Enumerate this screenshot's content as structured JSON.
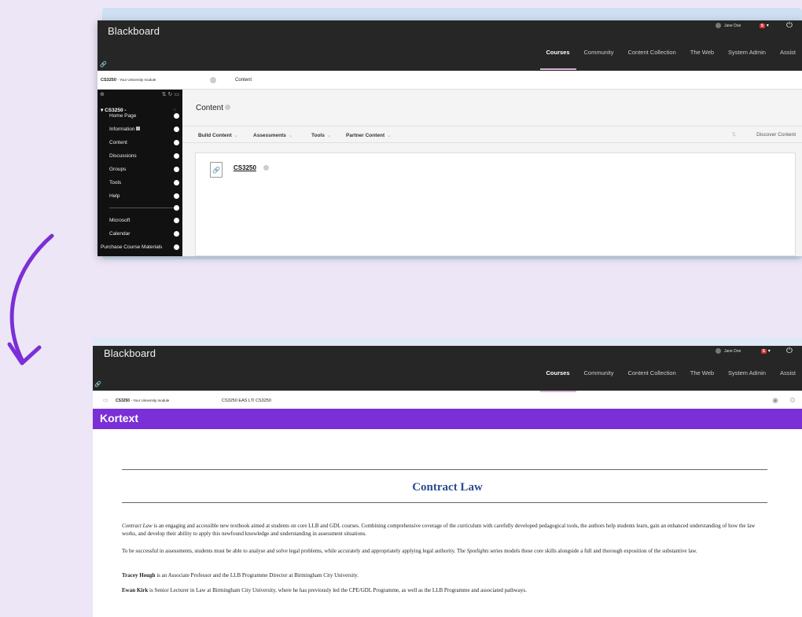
{
  "colors": {
    "kortext_purple": "#7b2fd6",
    "title_blue": "#2a4c93",
    "arrow_purple": "#7b2fd6"
  },
  "shot1": {
    "header": {
      "logo": "Blackboard",
      "user": "Jane Doe",
      "badge": "5",
      "nav": [
        "Courses",
        "Community",
        "Content Collection",
        "The Web",
        "System Admin",
        "Assist"
      ]
    },
    "breadcrumb": {
      "course_code": "CS3250",
      "course_desc": "- Your University module",
      "page": "Content"
    },
    "sidebar": {
      "course": "CS3250 -",
      "items": [
        "Home Page",
        "Information",
        "Content",
        "Discussions",
        "Groups",
        "Tools",
        "Help",
        "Microsoft",
        "Calendar",
        "Purchase Course Materials"
      ]
    },
    "main": {
      "title": "Content",
      "toolbar": [
        "Build Content",
        "Assessments",
        "Tools",
        "Partner Content"
      ],
      "discover": "Discover Content",
      "item_title": "CS3250"
    }
  },
  "shot2": {
    "header": {
      "logo": "Blackboard",
      "user": "Jane Doe",
      "badge": "5",
      "nav": [
        "Courses",
        "Community",
        "Content Collection",
        "The Web",
        "System Admin",
        "Assist"
      ]
    },
    "breadcrumb": {
      "course_code": "CS3250",
      "course_desc": "- Your University module",
      "tool": "CS3250 EAS LTI CS3250"
    },
    "kortext": {
      "brand": "Kortext",
      "book_title": "Contract Law",
      "para1_title": "Contract Law",
      "para1_rest": " is an engaging and accessible new textbook aimed at students on core LLB and GDL courses. Combining comprehensive coverage of the curriculum with carefully developed pedagogical tools, the authors help students learn, gain an enhanced understanding of how the law works, and develop their ability to apply this newfound knowledge and understanding in assessment situations.",
      "para2_start": "To be successful in assessments, students must be able to analyse and solve legal problems, while accurately and appropriately applying legal authority. The ",
      "para2_series": "Spotlights",
      "para2_end": " series models these core skills alongside a full and thorough exposition of the substantive law.",
      "author1_name": "Tracey Hough",
      "author1_bio": " is an Associate Professor and the LLB Programme Director at Birmingham City University.",
      "author2_name": "Ewan Kirk",
      "author2_bio": " is Senior Lecturer in Law at Birmingham City University, where he has previously led the CPE/GDL Programme, as well as the LLB Programme and associated pathways."
    }
  }
}
